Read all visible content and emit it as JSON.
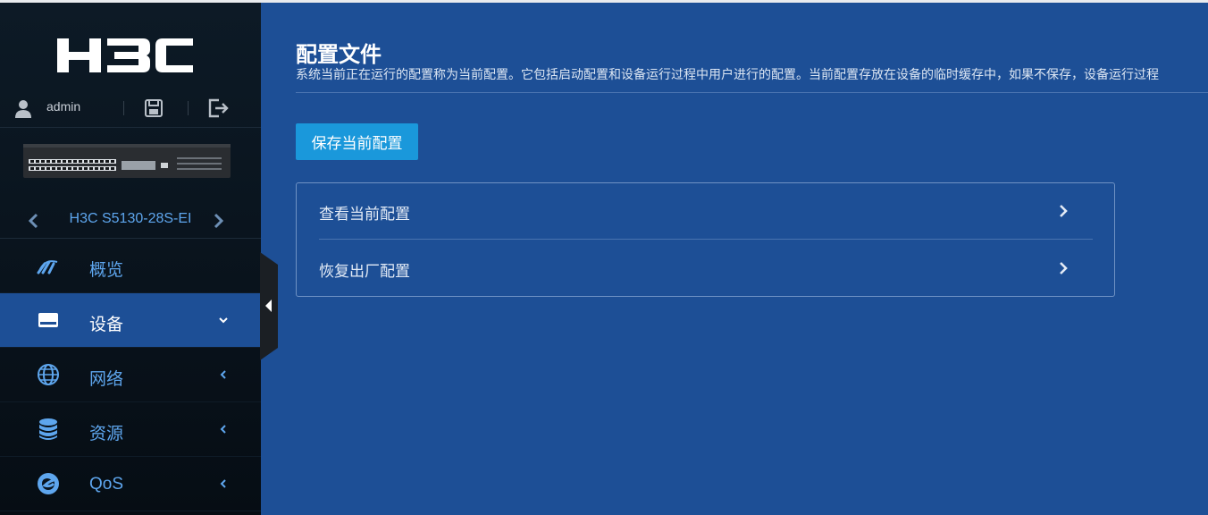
{
  "app": {
    "brand": "H3C",
    "username": "admin",
    "device_name": "H3C S5130-28S-EI"
  },
  "sidebar": {
    "icons": {
      "user": "user-icon",
      "save": "save-icon",
      "logout": "logout-icon",
      "prev": "chevron-left-icon",
      "next": "chevron-right-icon"
    },
    "menu": [
      {
        "label": "概览",
        "icon": "dashboard-gauge-icon",
        "active": false
      },
      {
        "label": "设备",
        "icon": "device-icon",
        "active": true,
        "expanded": true
      },
      {
        "label": "网络",
        "icon": "globe-icon",
        "active": false
      },
      {
        "label": "资源",
        "icon": "database-icon",
        "active": false
      },
      {
        "label": "QoS",
        "icon": "qos-icon",
        "active": false
      }
    ]
  },
  "main": {
    "title": "配置文件",
    "description": "系统当前正在运行的配置称为当前配置。它包括启动配置和设备运行过程中用户进行的配置。当前配置存放在设备的临时缓存中，如果不保存，设备运行过程",
    "save_button": "保存当前配置",
    "rows": [
      {
        "label": "查看当前配置"
      },
      {
        "label": "恢复出厂配置"
      }
    ]
  },
  "colors": {
    "main_bg": "#1d4f96",
    "sidebar_bg": "#0a141e",
    "accent_link": "#5ea6ee",
    "button": "#1a98db"
  }
}
